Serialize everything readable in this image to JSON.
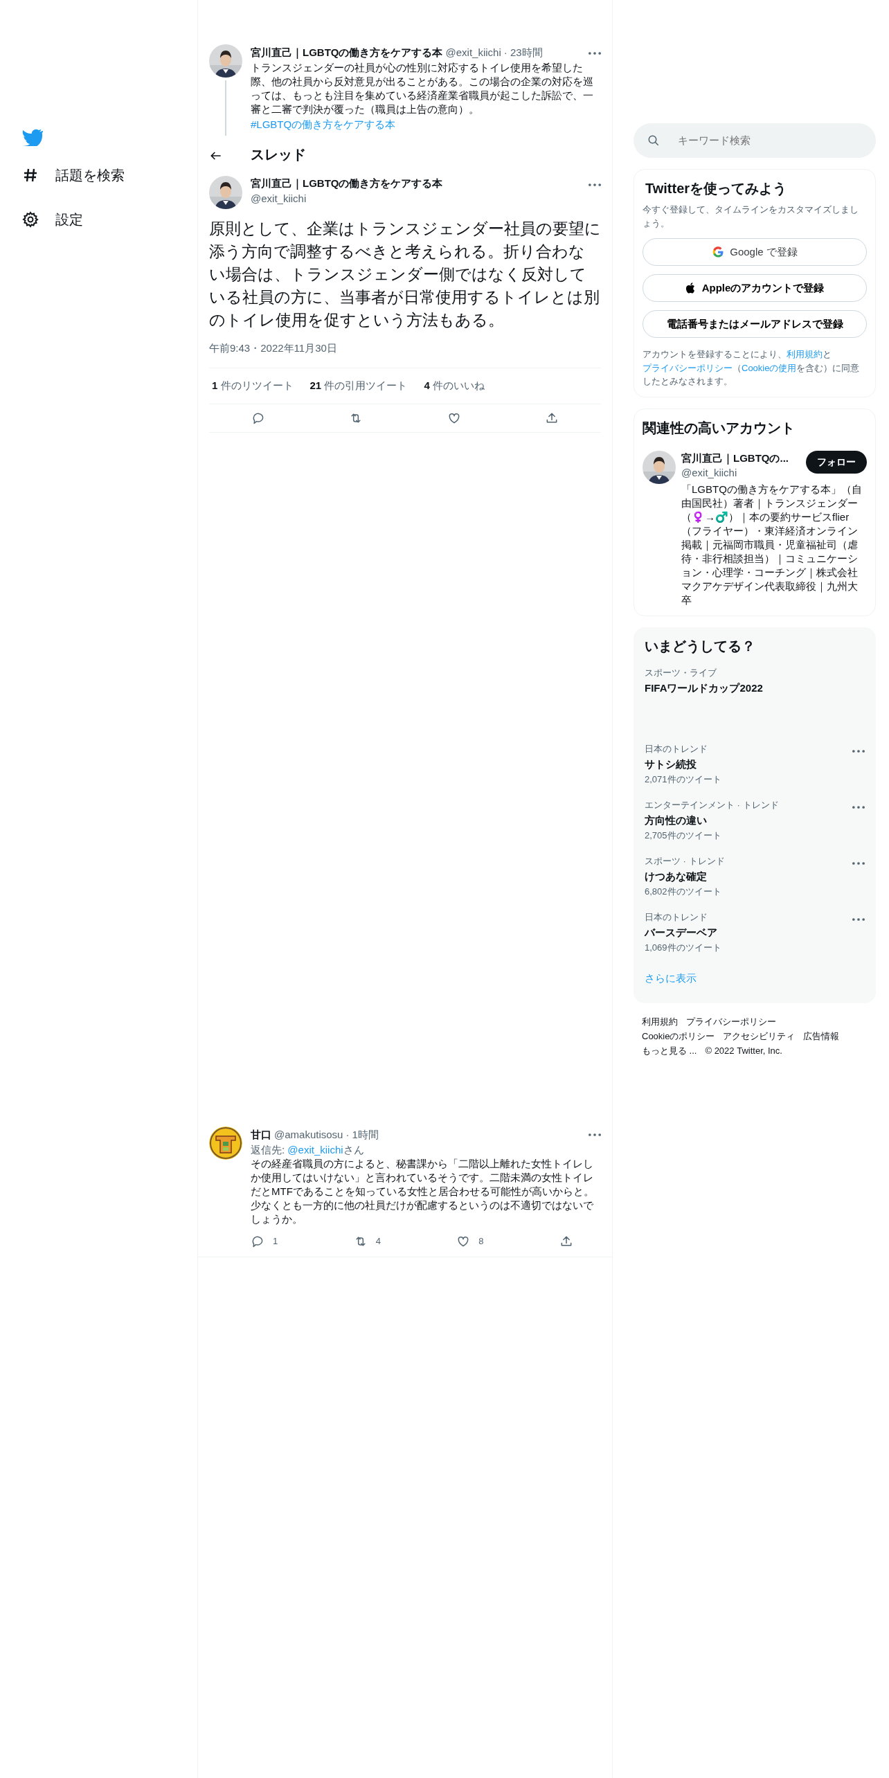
{
  "nav": {
    "items": [
      {
        "kind": "hashtag",
        "label": "話題を検索"
      },
      {
        "kind": "gear",
        "label": "設定"
      }
    ]
  },
  "parent_tweet": {
    "name": "宮川直己｜LGBTQの働き方をケアする本",
    "handle": "@exit_kiichi",
    "time": "· 23時間",
    "text": "トランスジェンダーの社員が心の性別に対応するトイレ使用を希望した際、他の社員から反対意見が出ることがある。この場合の企業の対応を巡っては、もっとも注目を集めている経済産業省職員が起こした訴訟で、一審と二審で判決が覆った（職員は上告の意向）。",
    "hashtag": "#LGBTQの働き方をケアする本"
  },
  "header": {
    "title": "スレッド"
  },
  "main_tweet": {
    "name": "宮川直己｜LGBTQの働き方をケアする本",
    "handle": "@exit_kiichi",
    "text": "原則として、企業はトランスジェンダー社員の要望に添う方向で調整するべきと考えられる。折り合わない場合は、トランスジェンダー側ではなく反対している社員の方に、当事者が日常使用するトイレとは別のトイレ使用を促すという方法もある。",
    "timestamp": "午前9:43・2022年11月30日",
    "stats": [
      {
        "count": "1",
        "label": "件のリツイート"
      },
      {
        "count": "21",
        "label": "件の引用ツイート"
      },
      {
        "count": "4",
        "label": "件のいいね"
      }
    ],
    "actions": [
      {
        "kind": "reply"
      },
      {
        "kind": "retweet"
      },
      {
        "kind": "like"
      },
      {
        "kind": "share"
      }
    ]
  },
  "reply": {
    "name": "甘口",
    "handle": "@amakutisosu",
    "time": "· 1時間",
    "reply_prefix": "返信先: ",
    "reply_to": "@exit_kiichi",
    "reply_suffix": "さん",
    "text": "その経産省職員の方によると、秘書課から「二階以上離れた女性トイレしか使用してはいけない」と言われているそうです。二階未満の女性トイレだとMTFであることを知っている女性と居合わせる可能性が高いからと。少なくとも一方的に他の社員だけが配慮するというのは不適切ではないでしょうか。",
    "actions": [
      {
        "kind": "reply",
        "count": "1"
      },
      {
        "kind": "retweet",
        "count": "4"
      },
      {
        "kind": "like",
        "count": "8"
      },
      {
        "kind": "share"
      }
    ]
  },
  "search": {
    "placeholder": "キーワード検索"
  },
  "signup": {
    "title": "Twitterを使ってみよう",
    "subtitle": "今すぐ登録して、タイムラインをカスタマイズしましょう。",
    "buttons": [
      {
        "kind": "google",
        "label": "Google で登録"
      },
      {
        "kind": "apple",
        "label": "Appleのアカウントで登録"
      },
      {
        "kind": "plain",
        "label": "電話番号またはメールアドレスで登録"
      }
    ],
    "legal": [
      {
        "kind": "text",
        "text": "アカウントを登録することにより、"
      },
      {
        "kind": "link",
        "text": "利用規約"
      },
      {
        "kind": "text",
        "text": "と"
      },
      {
        "kind": "link",
        "text": "プライバシーポリシー"
      },
      {
        "kind": "text",
        "text": "（"
      },
      {
        "kind": "link",
        "text": "Cookieの使用"
      },
      {
        "kind": "text",
        "text": "を含む）に同意したとみなされます。"
      }
    ]
  },
  "relevant": {
    "title": "関連性の高いアカウント",
    "name": "宮川直己｜LGBTQの...",
    "handle": "@exit_kiichi",
    "follow": "フォロー",
    "bio": "「LGBTQの働き方をケアする本」（自由国民社）著者｜トランスジェンダー（♀️→♂️）｜本の要約サービスflier（フライヤー）・東洋経済オンライン掲載｜元福岡市職員・児童福祉司（虐待・非行相談担当）｜コミュニケーション・心理学・コーチング｜株式会社マクアケデザイン代表取締役｜九州大卒"
  },
  "trends": {
    "title": "いまどうしてる？",
    "items": [
      {
        "kind": "event",
        "category": "スポーツ・ライブ",
        "title": "FIFAワールドカップ2022"
      },
      {
        "kind": "trend",
        "category": "日本のトレンド",
        "title": "サトシ続投",
        "count": "2,071件のツイート"
      },
      {
        "kind": "trend",
        "category": "エンターテインメント · トレンド",
        "title": "方向性の違い",
        "count": "2,705件のツイート"
      },
      {
        "kind": "trend",
        "category": "スポーツ · トレンド",
        "title": "けつあな確定",
        "count": "6,802件のツイート"
      },
      {
        "kind": "trend",
        "category": "日本のトレンド",
        "title": "バースデーベア",
        "count": "1,069件のツイート"
      }
    ],
    "more": "さらに表示"
  },
  "footer": [
    [
      "利用規約",
      "プライバシーポリシー"
    ],
    [
      "Cookieのポリシー",
      "アクセシビリティ",
      "広告情報"
    ],
    [
      "もっと見る ...",
      "© 2022 Twitter, Inc."
    ]
  ]
}
